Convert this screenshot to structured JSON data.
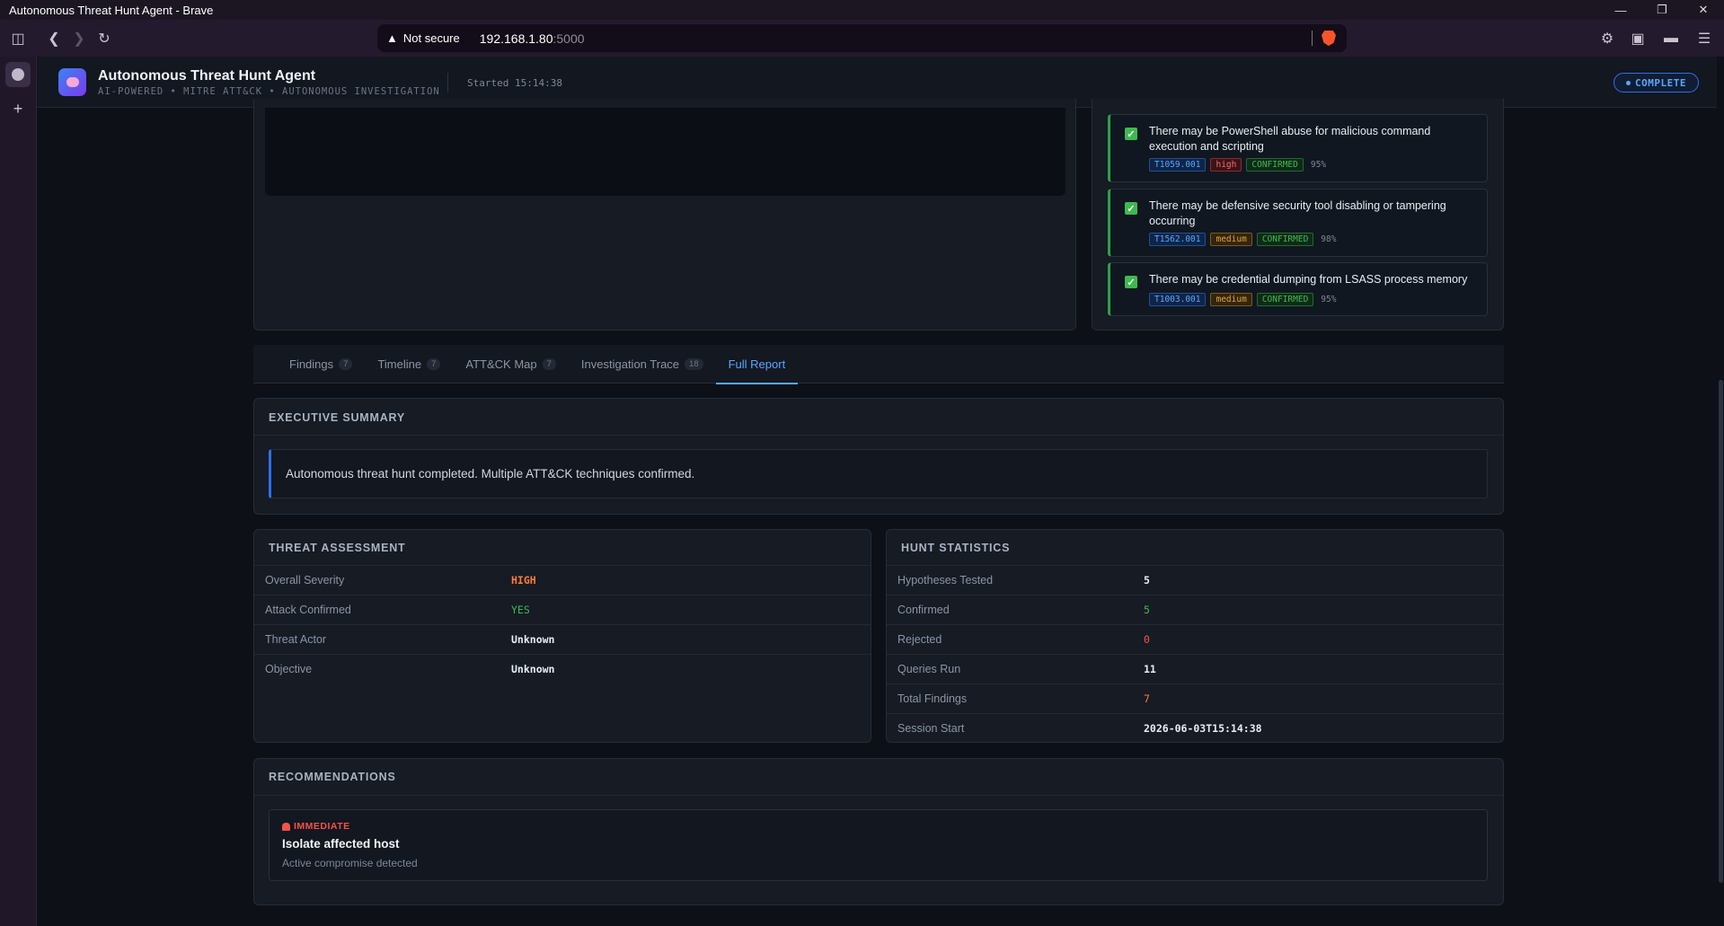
{
  "window": {
    "title": "Autonomous Threat Hunt Agent - Brave"
  },
  "browser": {
    "security_label": "Not secure",
    "url_host": "192.168.1.80",
    "url_port": ":5000"
  },
  "app": {
    "title": "Autonomous Threat Hunt Agent",
    "subtitle": "AI-POWERED • MITRE ATT&CK • AUTONOMOUS INVESTIGATION",
    "started": "Started 15:14:38",
    "status": "COMPLETE"
  },
  "hypotheses": [
    {
      "text": "There may be PowerShell abuse for malicious command execution and scripting",
      "technique": "T1059.001",
      "severity": "high",
      "status": "CONFIRMED",
      "confidence": "95%"
    },
    {
      "text": "There may be defensive security tool disabling or tampering occurring",
      "technique": "T1562.001",
      "severity": "medium",
      "status": "CONFIRMED",
      "confidence": "98%"
    },
    {
      "text": "There may be credential dumping from LSASS process memory",
      "technique": "T1003.001",
      "severity": "medium",
      "status": "CONFIRMED",
      "confidence": "95%"
    }
  ],
  "tabs": [
    {
      "label": "Findings",
      "count": "7"
    },
    {
      "label": "Timeline",
      "count": "7"
    },
    {
      "label": "ATT&CK Map",
      "count": "7"
    },
    {
      "label": "Investigation Trace",
      "count": "18"
    },
    {
      "label": "Full Report",
      "count": ""
    }
  ],
  "executive_summary": {
    "title": "EXECUTIVE SUMMARY",
    "text": "Autonomous threat hunt completed. Multiple ATT&CK techniques confirmed."
  },
  "threat_assessment": {
    "title": "THREAT ASSESSMENT",
    "rows": [
      {
        "key": "Overall Severity",
        "value": "HIGH"
      },
      {
        "key": "Attack Confirmed",
        "value": "YES"
      },
      {
        "key": "Threat Actor",
        "value": "Unknown"
      },
      {
        "key": "Objective",
        "value": "Unknown"
      }
    ]
  },
  "hunt_statistics": {
    "title": "HUNT STATISTICS",
    "rows": [
      {
        "key": "Hypotheses Tested",
        "value": "5"
      },
      {
        "key": "Confirmed",
        "value": "5"
      },
      {
        "key": "Rejected",
        "value": "0"
      },
      {
        "key": "Queries Run",
        "value": "11"
      },
      {
        "key": "Total Findings",
        "value": "7"
      },
      {
        "key": "Session Start",
        "value": "2026-06-03T15:14:38"
      }
    ]
  },
  "recommendations": {
    "title": "RECOMMENDATIONS",
    "items": [
      {
        "priority": "IMMEDIATE",
        "title": "Isolate affected host",
        "description": "Active compromise detected"
      }
    ]
  },
  "colors": {
    "accent": "#58a6ff",
    "severity_high": "#ff7b3a",
    "success": "#3fb950",
    "danger": "#f85149"
  }
}
